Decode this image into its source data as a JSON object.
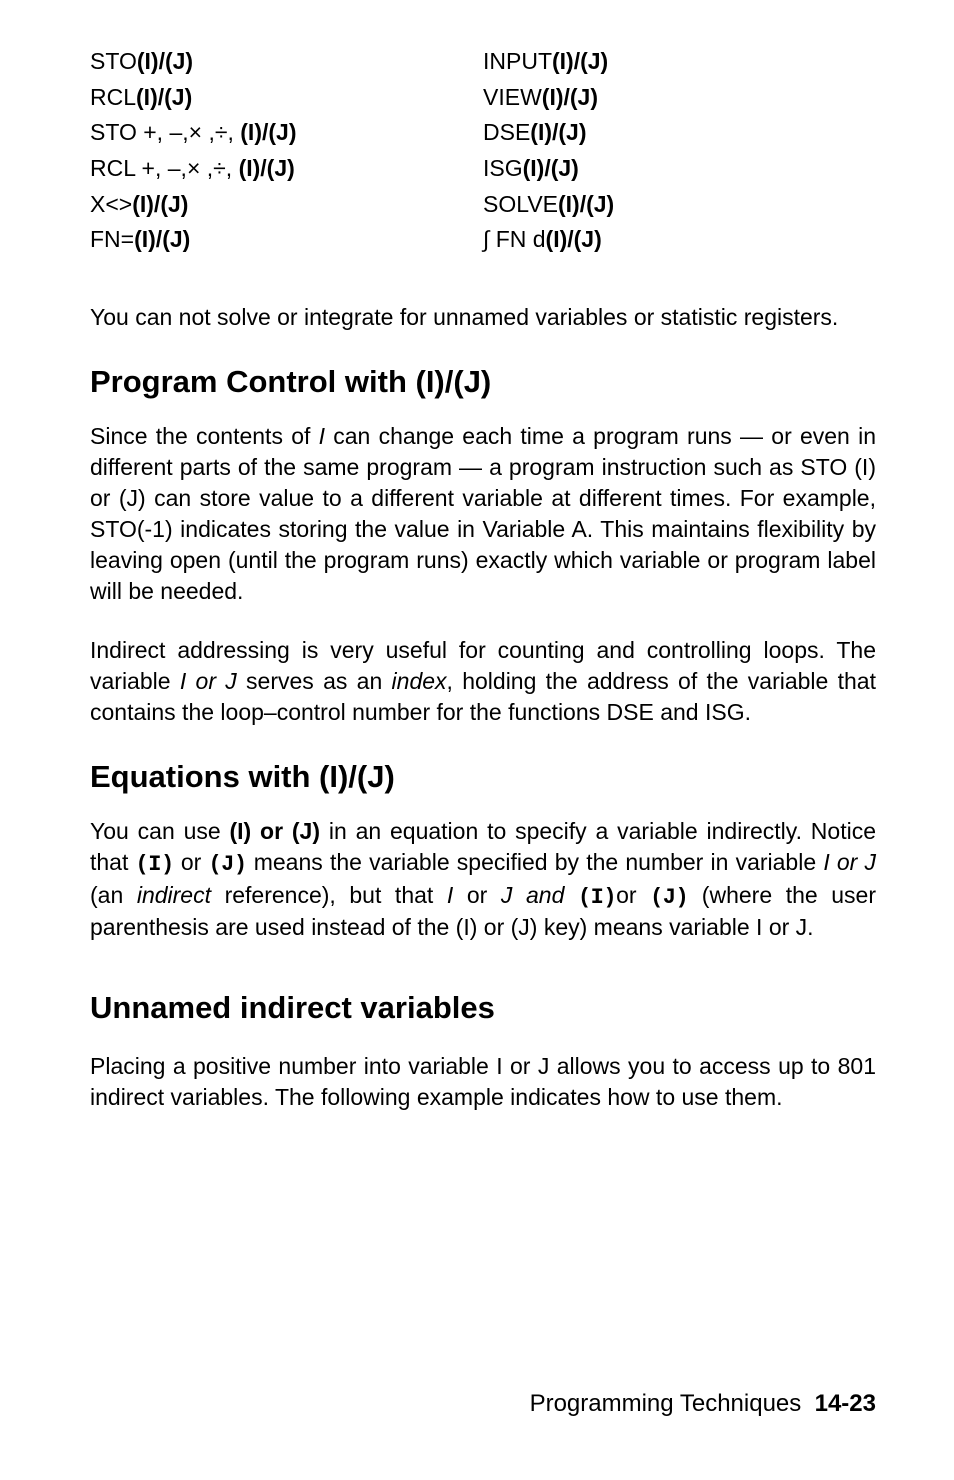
{
  "ops_left": [
    {
      "pre": "STO",
      "suf": "(I)/(J)"
    },
    {
      "pre": "RCL",
      "suf": "(I)/(J)"
    },
    {
      "pre": "STO +, –,× ,÷, ",
      "suf": "(I)/(J)"
    },
    {
      "pre": "RCL +, –,× ,÷, ",
      "suf": "(I)/(J)"
    },
    {
      "pre": "X<>",
      "suf": "(I)/(J)"
    },
    {
      "pre": "FN=",
      "suf": "(I)/(J)"
    }
  ],
  "ops_right": [
    {
      "pre": "INPUT",
      "suf": "(I)/(J)"
    },
    {
      "pre": "VIEW",
      "suf": "(I)/(J)"
    },
    {
      "pre": "DSE",
      "suf": "(I)/(J)"
    },
    {
      "pre": "ISG",
      "suf": "(I)/(J)"
    },
    {
      "pre": "SOLVE",
      "suf": "(I)/(J)"
    },
    {
      "pre": "∫ FN d",
      "suf": "(I)/(J)"
    }
  ],
  "p_solve_note": "You can not solve or integrate for unnamed variables or statistic registers.",
  "h_program_control": "Program Control with (I)/(J)",
  "p_program_control_1_a": "Since the contents of ",
  "p_program_control_1_b": "I",
  "p_program_control_1_c": " can change each time a program runs — or even in different parts of the same program — a program instruction such as STO (I) or (J) can store value to a different variable at different times. For example, STO(-1) indicates storing the value in Variable A. This maintains flexibility by leaving open (until the program runs) exactly which variable or program label will be needed.",
  "p_program_control_2_a": "Indirect addressing is very useful for counting and controlling loops. The variable ",
  "p_program_control_2_b": "I or J",
  "p_program_control_2_c": " serves as an ",
  "p_program_control_2_d": "index",
  "p_program_control_2_e": ", holding the address of the variable that contains the loop–control number for the functions DSE and ISG.",
  "h_equations": "Equations with (I)/(J)",
  "p_eq_a": "You can use ",
  "p_eq_b": "(I) or (J)",
  "p_eq_c": " in an equation to specify a variable indirectly. Notice that ",
  "p_eq_d": "(I)",
  "p_eq_e": " or ",
  "p_eq_f": "(J)",
  "p_eq_g": " means the variable specified by the number in variable ",
  "p_eq_h": "I or J",
  "p_eq_i": " (an ",
  "p_eq_j": "indirect",
  "p_eq_k": " reference), but that ",
  "p_eq_l": "I",
  "p_eq_m": " or ",
  "p_eq_n": "J and ",
  "p_eq_o": "(I)",
  "p_eq_p": "or ",
  "p_eq_q": "(J)",
  "p_eq_r": " (where the user parenthesis are used instead of the (I) or (J) key) means variable I or J.",
  "h_unnamed": "Unnamed indirect variables",
  "p_unnamed": "Placing a positive number into variable I or J allows you to access up to 801 indirect variables. The following example indicates how to use them.",
  "footer_label": "Programming Techniques",
  "footer_page": "14-23"
}
